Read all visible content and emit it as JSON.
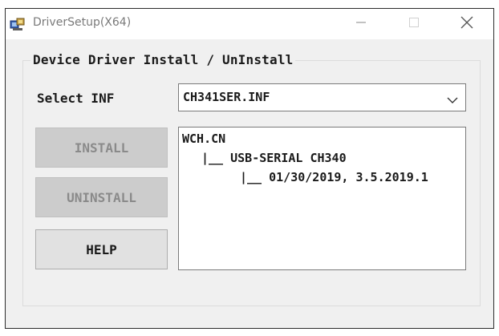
{
  "window": {
    "title": "DriverSetup(X64)",
    "app_icon": "driver-setup-icon"
  },
  "titlebar_buttons": {
    "minimize_icon": "minimize-icon",
    "maximize_icon": "maximize-icon",
    "close_icon": "close-icon"
  },
  "group": {
    "legend": "Device Driver Install / UnInstall"
  },
  "inf_select": {
    "label": "Select INF",
    "value": "CH341SER.INF",
    "arrow_icon": "chevron-down-icon"
  },
  "buttons": {
    "install": {
      "label": "INSTALL",
      "enabled": false
    },
    "uninstall": {
      "label": "UNINSTALL",
      "enabled": false
    },
    "help": {
      "label": "HELP",
      "enabled": true
    }
  },
  "driver_info": {
    "vendor": "WCH.CN",
    "device": "|__ USB-SERIAL CH340",
    "version": "|__ 01/30/2019, 3.5.2019.1"
  },
  "colors": {
    "client_bg": "#f0f0f0",
    "disabled_button_bg": "#cccccc",
    "enabled_button_bg": "#e1e1e1",
    "disabled_text": "#8a8a8a"
  }
}
